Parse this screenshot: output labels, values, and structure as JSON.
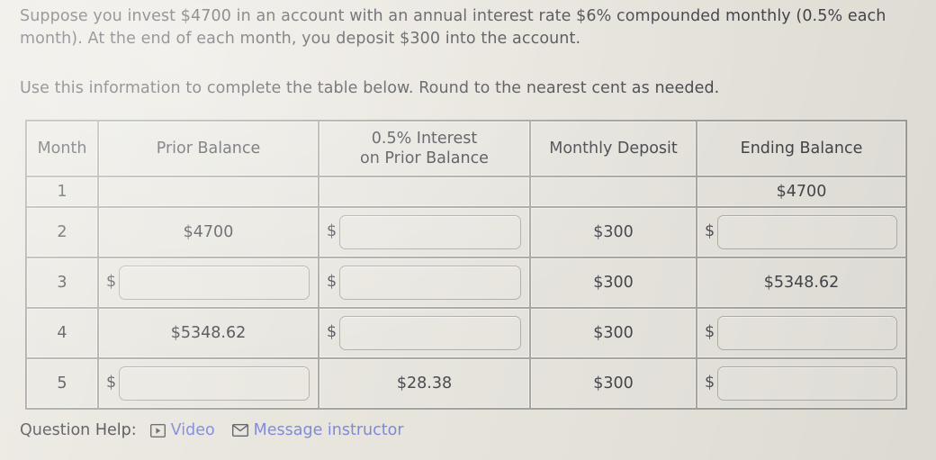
{
  "problem": {
    "statement_line1": "Suppose you invest $4700 in an account with an annual interest rate $6% compounded monthly (0.5% each",
    "statement_line2": "month). At the end of each month, you deposit $300 into the account.",
    "instruction": "Use this information to complete the table below. Round to the nearest cent as needed."
  },
  "table": {
    "headers": {
      "month": "Month",
      "prior_balance": "Prior Balance",
      "interest_line1": "0.5% Interest",
      "interest_line2": "on Prior Balance",
      "monthly_deposit": "Monthly Deposit",
      "ending_balance": "Ending Balance"
    },
    "rows": [
      {
        "month": "1",
        "prior_balance": {
          "type": "empty",
          "value": ""
        },
        "interest": {
          "type": "empty",
          "value": ""
        },
        "monthly_deposit": {
          "type": "empty",
          "value": ""
        },
        "ending_balance": {
          "type": "text",
          "value": "$4700"
        }
      },
      {
        "month": "2",
        "prior_balance": {
          "type": "text",
          "value": "$4700"
        },
        "interest": {
          "type": "input",
          "value": "",
          "prefix": "$"
        },
        "monthly_deposit": {
          "type": "text",
          "value": "$300"
        },
        "ending_balance": {
          "type": "input",
          "value": "",
          "prefix": "$"
        }
      },
      {
        "month": "3",
        "prior_balance": {
          "type": "input",
          "value": "",
          "prefix": "$"
        },
        "interest": {
          "type": "input",
          "value": "",
          "prefix": "$"
        },
        "monthly_deposit": {
          "type": "text",
          "value": "$300"
        },
        "ending_balance": {
          "type": "text",
          "value": "$5348.62"
        }
      },
      {
        "month": "4",
        "prior_balance": {
          "type": "text",
          "value": "$5348.62"
        },
        "interest": {
          "type": "input",
          "value": "",
          "prefix": "$"
        },
        "monthly_deposit": {
          "type": "text",
          "value": "$300"
        },
        "ending_balance": {
          "type": "input",
          "value": "",
          "prefix": "$"
        }
      },
      {
        "month": "5",
        "prior_balance": {
          "type": "input",
          "value": "",
          "prefix": "$"
        },
        "interest": {
          "type": "text",
          "value": "$28.38"
        },
        "monthly_deposit": {
          "type": "text",
          "value": "$300"
        },
        "ending_balance": {
          "type": "input",
          "value": "",
          "prefix": "$"
        }
      }
    ]
  },
  "footer": {
    "label": "Question Help:",
    "video_link": "Video",
    "video_icon": "play-box-icon",
    "message_link": "Message instructor",
    "message_icon": "envelope-icon"
  },
  "colors": {
    "page_background": "#e8e5dd",
    "cell_background": "#e7e5de",
    "cell_border": "#a9a8a2",
    "text": "#44454b",
    "link": "#7b86d6"
  }
}
